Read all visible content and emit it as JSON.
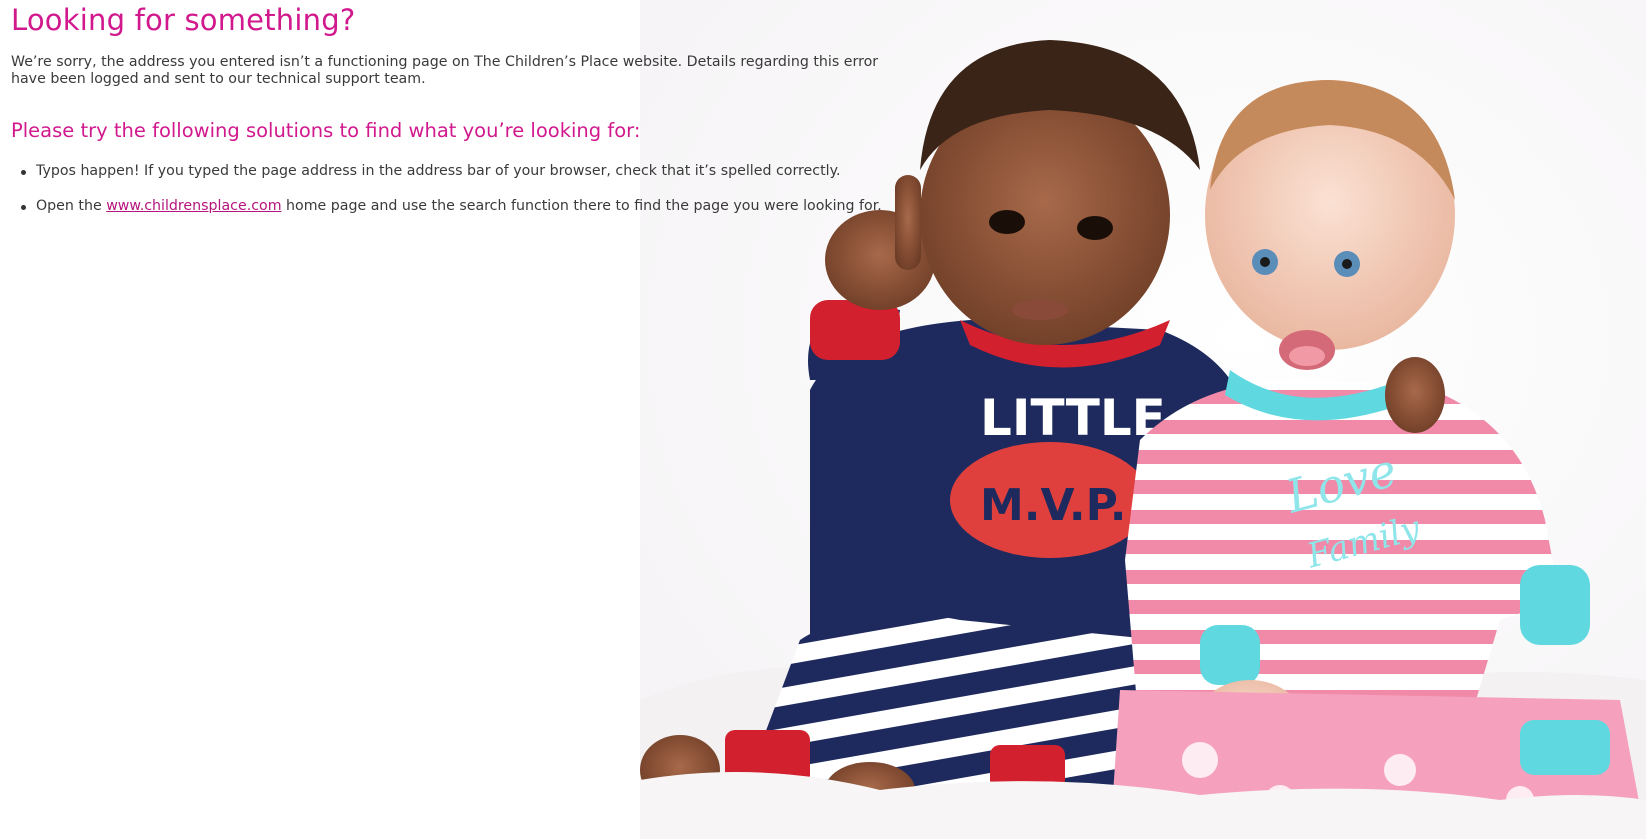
{
  "page": {
    "title": "Looking for something?",
    "intro": "We’re sorry, the address you entered isn’t a functioning page on The Children’s Place website. Details regarding this error have been logged and sent to our technical support team.",
    "subtitle": "Please try the following solutions to find what you’re looking for:",
    "solutions": {
      "item1": "Typos happen! If you typed the page address in the address bar of your browser, check that it’s spelled correctly.",
      "item2_prefix": "Open the ",
      "item2_link": "www.childrensplace.com",
      "item2_suffix": " home page and use the search function there to find the page you were looking for."
    }
  },
  "photo": {
    "shirt_text": "LITTLE",
    "football_text": "M.V.P.",
    "script_text": "Love",
    "script_text2": "Family"
  },
  "colors": {
    "accent": "#d1198d",
    "link": "#b5147c",
    "body_text": "#3a3a3a",
    "navy": "#1e2a5e",
    "red": "#d3202f",
    "pink_stripe": "#f08aa8",
    "aqua": "#5fd8e0"
  }
}
